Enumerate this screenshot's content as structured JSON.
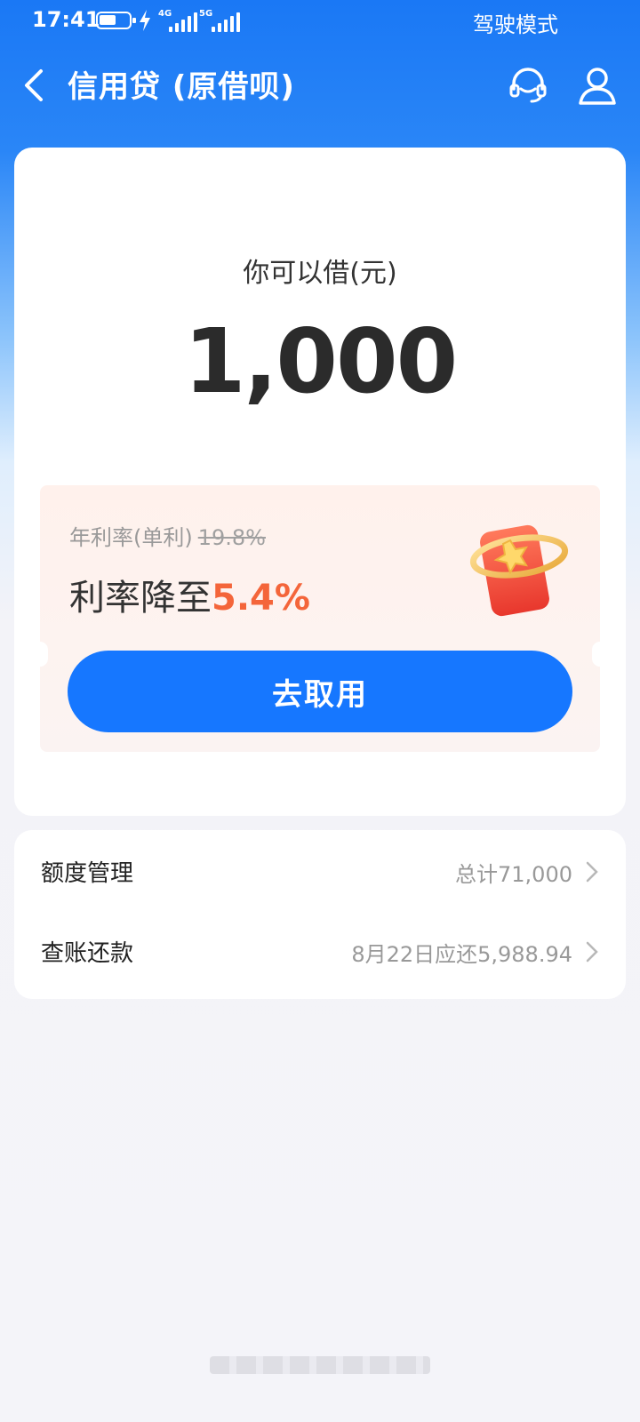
{
  "status": {
    "time": "17:41",
    "net1": "4G",
    "net2": "5G",
    "mode": "驾驶模式"
  },
  "nav": {
    "title": "信用贷 (原借呗)"
  },
  "loan": {
    "label": "你可以借(元)",
    "amount": "1,000"
  },
  "promo": {
    "rate_label": "年利率(单利)",
    "old_rate": "19.8%",
    "rate_text": "利率降至",
    "new_rate": "5.4%",
    "button": "去取用"
  },
  "list": [
    {
      "label": "额度管理",
      "value": "总计71,000"
    },
    {
      "label": "查账还款",
      "value": "8月22日应还5,988.94"
    }
  ],
  "colors": {
    "primary": "#1677ff",
    "accent": "#f4653a"
  }
}
